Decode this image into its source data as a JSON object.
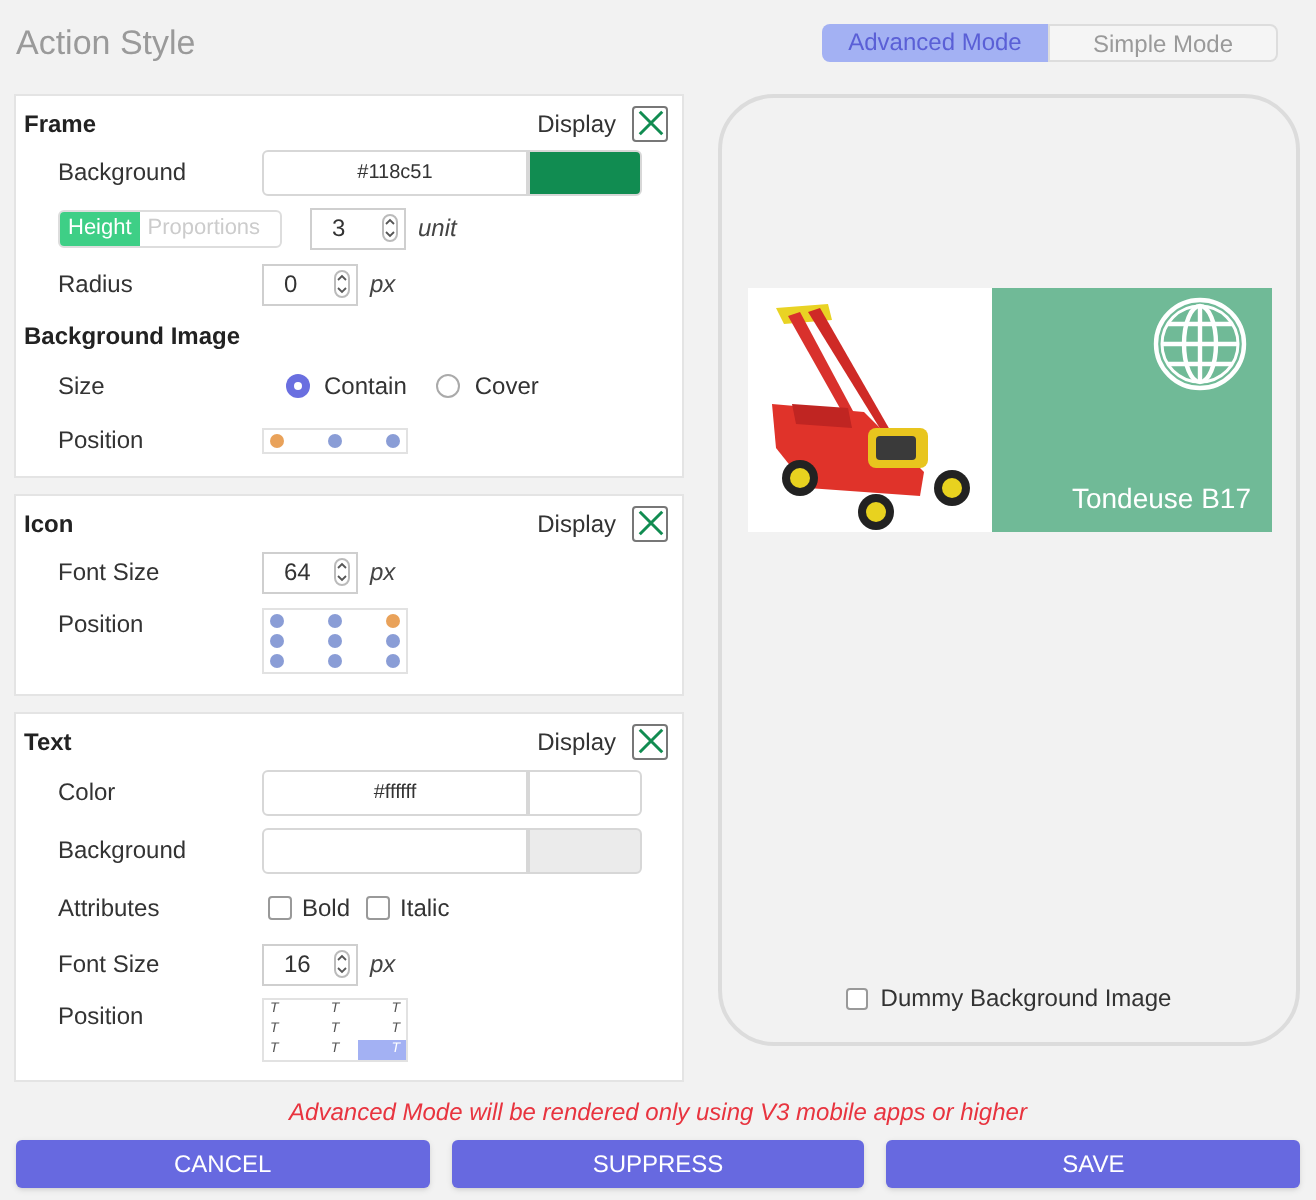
{
  "title": "Action Style",
  "mode_toggle": [
    {
      "label": "Advanced Mode",
      "selected": true
    },
    {
      "label": "Simple Mode",
      "selected": false
    }
  ],
  "frame": {
    "heading": "Frame",
    "display_label": "Display",
    "display_checked": true,
    "background": {
      "label": "Background",
      "value": "#118c51"
    },
    "size_mode": [
      {
        "label": "Height",
        "selected": true
      },
      {
        "label": "Proportions",
        "selected": false
      }
    ],
    "size_value": "3",
    "size_unit": "unit",
    "radius": {
      "label": "Radius",
      "value": "0",
      "unit": "px"
    }
  },
  "background_image": {
    "heading": "Background Image",
    "size_label": "Size",
    "size_options": [
      {
        "label": "Contain",
        "selected": true
      },
      {
        "label": "Cover",
        "selected": false
      }
    ],
    "position_label": "Position",
    "position": [
      {
        "selected": true
      },
      {
        "selected": false
      },
      {
        "selected": false
      }
    ]
  },
  "icon": {
    "heading": "Icon",
    "display_label": "Display",
    "display_checked": true,
    "font_size": {
      "label": "Font Size",
      "value": "64",
      "unit": "px"
    },
    "position_label": "Position",
    "position": [
      {
        "selected": false
      },
      {
        "selected": false
      },
      {
        "selected": true
      },
      {
        "selected": false
      },
      {
        "selected": false
      },
      {
        "selected": false
      },
      {
        "selected": false
      },
      {
        "selected": false
      },
      {
        "selected": false
      }
    ]
  },
  "text": {
    "heading": "Text",
    "display_label": "Display",
    "display_checked": true,
    "color": {
      "label": "Color",
      "value": "#ffffff"
    },
    "background": {
      "label": "Background"
    },
    "attributes_label": "Attributes",
    "attributes": [
      {
        "label": "Bold",
        "checked": false
      },
      {
        "label": "Italic",
        "checked": false
      }
    ],
    "font_size": {
      "label": "Font Size",
      "value": "16",
      "unit": "px"
    },
    "position_label": "Position",
    "position": [
      {
        "label": "T",
        "selected": false
      },
      {
        "label": "T",
        "selected": false
      },
      {
        "label": "T",
        "selected": false
      },
      {
        "label": "T",
        "selected": false
      },
      {
        "label": "T",
        "selected": false
      },
      {
        "label": "T",
        "selected": false
      },
      {
        "label": "T",
        "selected": false
      },
      {
        "label": "T",
        "selected": false
      },
      {
        "label": "T",
        "selected": true
      }
    ]
  },
  "preview": {
    "caption": "Tondeuse B17",
    "dummy_background": {
      "label": "Dummy Background Image",
      "checked": false
    }
  },
  "warning": "Advanced Mode will be rendered only using V3 mobile apps or higher",
  "buttons": [
    "CANCEL",
    "SUPPRESS",
    "SAVE"
  ]
}
